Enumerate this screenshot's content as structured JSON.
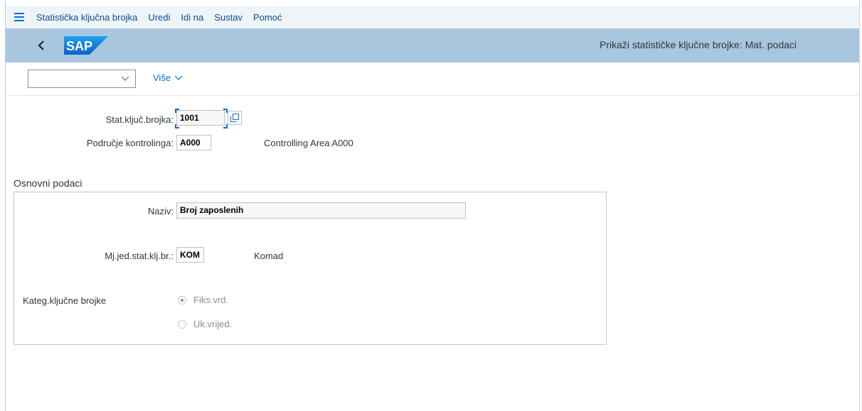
{
  "menu": {
    "items": [
      "Statistička ključna brojka",
      "Uredi",
      "Idi na",
      "Sustav",
      "Pomoć"
    ]
  },
  "header": {
    "logo_text": "SAP",
    "title": "Prikaži statističke ključne brojke: Mat. podaci"
  },
  "toolbar": {
    "dropdown_value": "",
    "more_label": "Više"
  },
  "fields": {
    "stat_key_label": "Stat.ključ.brojka:",
    "stat_key_value": "1001",
    "controlling_area_label": "Područje kontrolinga:",
    "controlling_area_value": "A000",
    "controlling_area_desc": "Controlling Area A000"
  },
  "basic_data": {
    "section_title": "Osnovni podaci",
    "name_label": "Naziv:",
    "name_value": "Broj zaposlenih",
    "unit_label": "Mj.jed.stat.klj.br.:",
    "unit_value": "KOM",
    "unit_desc": "Komad",
    "category_label": "Kateg.ključne brojke",
    "category_options": [
      {
        "label": "Fiks.vrd.",
        "selected": true
      },
      {
        "label": "Uk.vrijed.",
        "selected": false
      }
    ]
  },
  "colors": {
    "menubar_bg": "#eff4f9",
    "shellbar_bg": "#a9c6df",
    "accent": "#0a6ed1",
    "logo_blue": "#0f7dd6"
  },
  "icons": [
    "menu-icon",
    "back-icon",
    "sap-logo",
    "chevron-down-icon",
    "value-help-icon"
  ]
}
